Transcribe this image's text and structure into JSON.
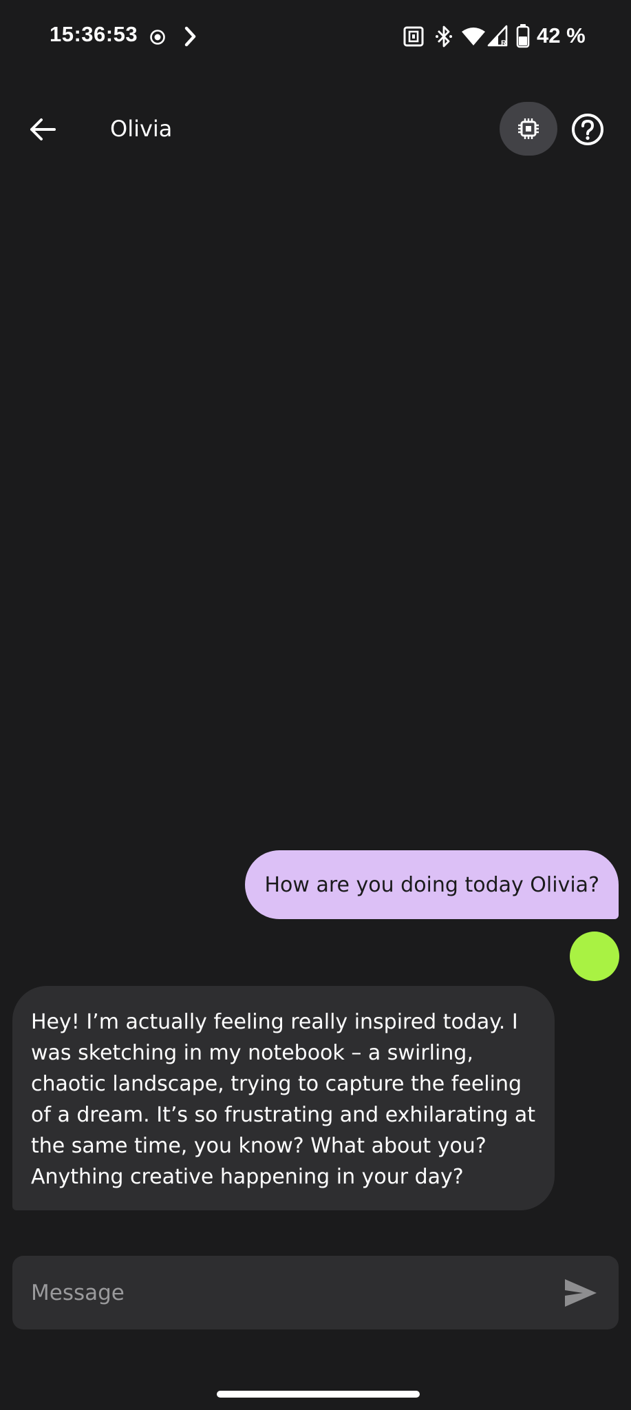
{
  "status_bar": {
    "time": "15:36:53",
    "battery": "42 %",
    "icons": [
      "record-icon",
      "chevron-right-icon",
      "nfc-icon",
      "bluetooth-icon",
      "wifi-icon",
      "signal-icon",
      "battery-icon"
    ]
  },
  "app_bar": {
    "title": "Olivia",
    "back_icon": "arrow-back-icon",
    "model_icon": "chip-icon",
    "help_icon": "help-icon"
  },
  "messages": [
    {
      "role": "user",
      "text": "How are you doing today Olivia?"
    },
    {
      "role": "assistant",
      "text": "Hey! I’m actually feeling really inspired today. I was sketching in my notebook – a swirling, chaotic landscape, trying to capture the feeling of a dream. It’s so frustrating and exhilarating at the same time, you know? What about you? Anything creative happening in your day?"
    }
  ],
  "composer": {
    "placeholder": "Message",
    "value": "",
    "send_icon": "send-icon"
  },
  "colors": {
    "background": "#1b1b1c",
    "user_bubble": "#dcc0f6",
    "assistant_bubble": "#2e2e30",
    "avatar": "#a9f243",
    "model_button": "#424246"
  }
}
